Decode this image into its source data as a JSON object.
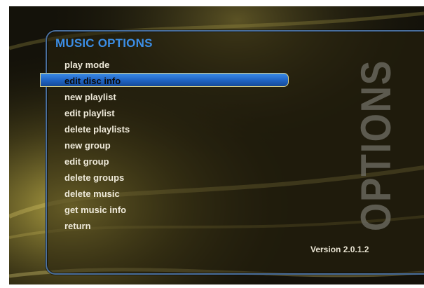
{
  "screen": {
    "title": "MUSIC OPTIONS",
    "side_word": "OPTIONS",
    "version": "Version 2.0.1.2",
    "accent_color": "#3c8ee6",
    "highlight_color": "#1f63c2",
    "selected_index": 1
  },
  "menu": {
    "items": [
      {
        "label": "play mode"
      },
      {
        "label": "edit disc info"
      },
      {
        "label": "new playlist"
      },
      {
        "label": "edit playlist"
      },
      {
        "label": "delete playlists"
      },
      {
        "label": "new group"
      },
      {
        "label": "edit group"
      },
      {
        "label": "delete groups"
      },
      {
        "label": "delete music"
      },
      {
        "label": "get music info"
      },
      {
        "label": "return"
      }
    ]
  }
}
